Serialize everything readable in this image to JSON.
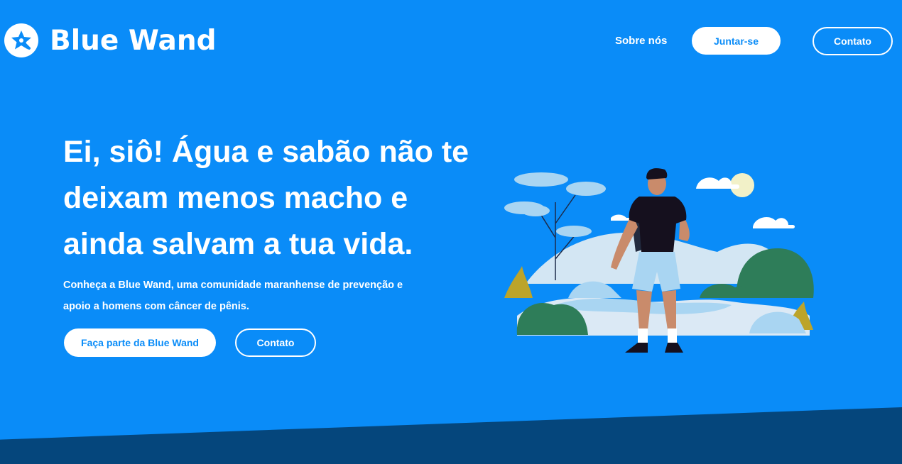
{
  "header": {
    "brand_name": "Blue Wand",
    "logo_icon": "star-badge-icon",
    "nav": {
      "about_label": "Sobre nós",
      "join_label": "Juntar-se",
      "contact_label": "Contato"
    }
  },
  "hero": {
    "title": "Ei, siô! Água e sabão não te deixam menos macho e ainda salvam a tua vida.",
    "subtitle": "Conheça a Blue Wand, uma comunidade maranhense de prevenção e apoio a homens com câncer de pênis.",
    "primary_cta": "Faça parte da Blue Wand",
    "secondary_cta": "Contato"
  },
  "colors": {
    "background": "#0a8cf8",
    "bottom_band": "#05467c",
    "text": "#ffffff"
  }
}
